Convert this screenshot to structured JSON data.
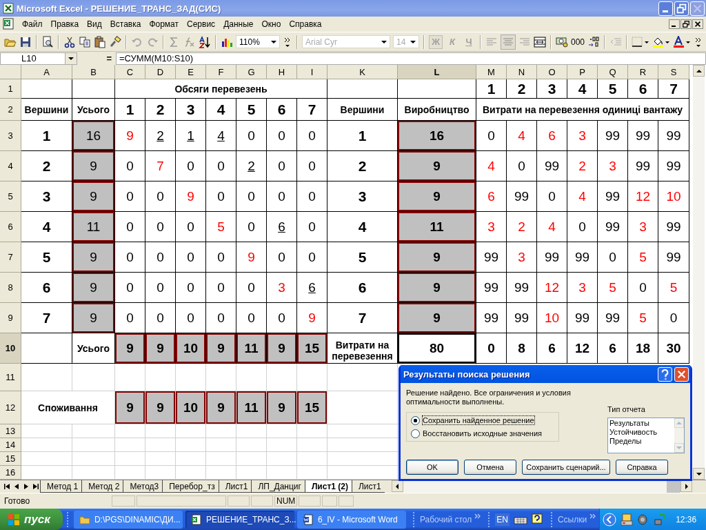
{
  "window": {
    "title": "Microsoft Excel - РЕШЕНИЕ_ТРАНС_ЗАД(СИС)"
  },
  "menu": [
    "Файл",
    "Правка",
    "Вид",
    "Вставка",
    "Формат",
    "Сервис",
    "Данные",
    "Окно",
    "Справка"
  ],
  "toolbar": {
    "zoom": "110%",
    "font": "Arial Cyr",
    "font_size": "14",
    "format_buttons": [
      {
        "label": "Ж",
        "pressed": true
      },
      {
        "label": "К",
        "pressed": false
      },
      {
        "label": "Ч",
        "pressed": false
      }
    ],
    "thousands": "000"
  },
  "formula_bar": {
    "name_box": "L10",
    "equals": "=",
    "formula": "=СУММ(M10:S10)"
  },
  "sheet": {
    "columns": [
      {
        "label": "A",
        "selected": false
      },
      {
        "label": "B",
        "selected": false
      },
      {
        "label": "C",
        "selected": false
      },
      {
        "label": "D",
        "selected": false
      },
      {
        "label": "E",
        "selected": false
      },
      {
        "label": "F",
        "selected": false
      },
      {
        "label": "G",
        "selected": false
      },
      {
        "label": "H",
        "selected": false
      },
      {
        "label": "I",
        "selected": false
      },
      {
        "label": "K",
        "selected": false
      },
      {
        "label": "L",
        "selected": true
      },
      {
        "label": "M",
        "selected": false
      },
      {
        "label": "N",
        "selected": false
      },
      {
        "label": "O",
        "selected": false
      },
      {
        "label": "P",
        "selected": false
      },
      {
        "label": "Q",
        "selected": false
      },
      {
        "label": "R",
        "selected": false
      },
      {
        "label": "S",
        "selected": false
      }
    ],
    "rows": [
      {
        "header": "1",
        "selected": false,
        "cells": [
          "",
          "",
          "",
          "",
          {
            "kind": "centered_heading",
            "text": "Обсяги перевезень"
          },
          "",
          "",
          "",
          "",
          "",
          "",
          {
            "kind": "index",
            "text": "1"
          },
          {
            "kind": "index",
            "text": "2"
          },
          {
            "kind": "index",
            "text": "3"
          },
          {
            "kind": "index",
            "text": "4"
          },
          {
            "kind": "index",
            "text": "5"
          },
          {
            "kind": "index",
            "text": "6"
          },
          {
            "kind": "index",
            "text": "7"
          }
        ]
      },
      {
        "header": "2",
        "selected": false,
        "cells": [
          {
            "kind": "heading",
            "text": "Вершини"
          },
          {
            "kind": "heading",
            "text": "Усього"
          },
          {
            "kind": "index",
            "text": "1"
          },
          {
            "kind": "index",
            "text": "2"
          },
          {
            "kind": "index",
            "text": "3"
          },
          {
            "kind": "index",
            "text": "4"
          },
          {
            "kind": "index",
            "text": "5"
          },
          {
            "kind": "index",
            "text": "6"
          },
          {
            "kind": "index",
            "text": "7"
          },
          {
            "kind": "heading",
            "text": "Вершини"
          },
          {
            "kind": "heading",
            "text": "Виробництво"
          },
          {
            "kind": "wide_heading",
            "text": "Витрати на перевезення одиниці вантажу"
          }
        ]
      },
      {
        "header": "3",
        "selected": false,
        "cells": [
          {
            "kind": "index",
            "text": "1"
          },
          {
            "kind": "shaded",
            "text": "16"
          },
          {
            "kind": "value",
            "color": "#ff0000",
            "text": "9"
          },
          {
            "kind": "value",
            "underline": true,
            "text": "2"
          },
          {
            "kind": "value",
            "underline": true,
            "text": "1"
          },
          {
            "kind": "value",
            "underline": true,
            "text": "4"
          },
          {
            "kind": "value",
            "text": "0"
          },
          {
            "kind": "value",
            "text": "0"
          },
          {
            "kind": "value",
            "text": "0"
          },
          {
            "kind": "index",
            "text": "1"
          },
          {
            "kind": "total",
            "text": "16"
          },
          {
            "kind": "value",
            "text": "0"
          },
          {
            "kind": "value",
            "color": "#ff0000",
            "text": "4"
          },
          {
            "kind": "value",
            "color": "#ff0000",
            "text": "6"
          },
          {
            "kind": "value",
            "color": "#ff0000",
            "text": "3"
          },
          {
            "kind": "value",
            "text": "99"
          },
          {
            "kind": "value",
            "text": "99"
          },
          {
            "kind": "value",
            "text": "99"
          }
        ]
      },
      {
        "header": "4",
        "selected": false,
        "cells": [
          {
            "kind": "index",
            "text": "2"
          },
          {
            "kind": "shaded",
            "text": "9"
          },
          {
            "kind": "value",
            "text": "0"
          },
          {
            "kind": "value",
            "color": "#ff0000",
            "text": "7"
          },
          {
            "kind": "value",
            "text": "0"
          },
          {
            "kind": "value",
            "text": "0"
          },
          {
            "kind": "value",
            "underline": true,
            "text": "2"
          },
          {
            "kind": "value",
            "text": "0"
          },
          {
            "kind": "value",
            "text": "0"
          },
          {
            "kind": "index",
            "text": "2"
          },
          {
            "kind": "total",
            "text": "9"
          },
          {
            "kind": "value",
            "color": "#ff0000",
            "text": "4"
          },
          {
            "kind": "value",
            "text": "0"
          },
          {
            "kind": "value",
            "text": "99"
          },
          {
            "kind": "value",
            "color": "#ff0000",
            "text": "2"
          },
          {
            "kind": "value",
            "color": "#ff0000",
            "text": "3"
          },
          {
            "kind": "value",
            "text": "99"
          },
          {
            "kind": "value",
            "text": "99"
          }
        ]
      },
      {
        "header": "5",
        "selected": false,
        "cells": [
          {
            "kind": "index",
            "text": "3"
          },
          {
            "kind": "shaded",
            "text": "9"
          },
          {
            "kind": "value",
            "text": "0"
          },
          {
            "kind": "value",
            "text": "0"
          },
          {
            "kind": "value",
            "color": "#ff0000",
            "text": "9"
          },
          {
            "kind": "value",
            "text": "0"
          },
          {
            "kind": "value",
            "text": "0"
          },
          {
            "kind": "value",
            "text": "0"
          },
          {
            "kind": "value",
            "text": "0"
          },
          {
            "kind": "index",
            "text": "3"
          },
          {
            "kind": "total",
            "text": "9"
          },
          {
            "kind": "value",
            "color": "#ff0000",
            "text": "6"
          },
          {
            "kind": "value",
            "text": "99"
          },
          {
            "kind": "value",
            "text": "0"
          },
          {
            "kind": "value",
            "color": "#ff0000",
            "text": "4"
          },
          {
            "kind": "value",
            "text": "99"
          },
          {
            "kind": "value",
            "color": "#ff0000",
            "text": "12"
          },
          {
            "kind": "value",
            "color": "#ff0000",
            "text": "10"
          }
        ]
      },
      {
        "header": "6",
        "selected": false,
        "cells": [
          {
            "kind": "index",
            "text": "4"
          },
          {
            "kind": "shaded",
            "text": "11"
          },
          {
            "kind": "value",
            "text": "0"
          },
          {
            "kind": "value",
            "text": "0"
          },
          {
            "kind": "value",
            "text": "0"
          },
          {
            "kind": "value",
            "color": "#ff0000",
            "text": "5"
          },
          {
            "kind": "value",
            "text": "0"
          },
          {
            "kind": "value",
            "underline": true,
            "text": "6"
          },
          {
            "kind": "value",
            "text": "0"
          },
          {
            "kind": "index",
            "text": "4"
          },
          {
            "kind": "total",
            "text": "11"
          },
          {
            "kind": "value",
            "color": "#ff0000",
            "text": "3"
          },
          {
            "kind": "value",
            "color": "#ff0000",
            "text": "2"
          },
          {
            "kind": "value",
            "color": "#ff0000",
            "text": "4"
          },
          {
            "kind": "value",
            "text": "0"
          },
          {
            "kind": "value",
            "text": "99"
          },
          {
            "kind": "value",
            "color": "#ff0000",
            "text": "3"
          },
          {
            "kind": "value",
            "text": "99"
          }
        ]
      },
      {
        "header": "7",
        "selected": false,
        "cells": [
          {
            "kind": "index",
            "text": "5"
          },
          {
            "kind": "shaded",
            "text": "9"
          },
          {
            "kind": "value",
            "text": "0"
          },
          {
            "kind": "value",
            "text": "0"
          },
          {
            "kind": "value",
            "text": "0"
          },
          {
            "kind": "value",
            "text": "0"
          },
          {
            "kind": "value",
            "color": "#ff0000",
            "text": "9"
          },
          {
            "kind": "value",
            "text": "0"
          },
          {
            "kind": "value",
            "text": "0"
          },
          {
            "kind": "index",
            "text": "5"
          },
          {
            "kind": "total",
            "text": "9"
          },
          {
            "kind": "value",
            "text": "99"
          },
          {
            "kind": "value",
            "color": "#ff0000",
            "text": "3"
          },
          {
            "kind": "value",
            "text": "99"
          },
          {
            "kind": "value",
            "text": "99"
          },
          {
            "kind": "value",
            "text": "0"
          },
          {
            "kind": "value",
            "color": "#ff0000",
            "text": "5"
          },
          {
            "kind": "value",
            "text": "99"
          }
        ]
      },
      {
        "header": "8",
        "selected": false,
        "cells": [
          {
            "kind": "index",
            "text": "6"
          },
          {
            "kind": "shaded",
            "text": "9"
          },
          {
            "kind": "value",
            "text": "0"
          },
          {
            "kind": "value",
            "text": "0"
          },
          {
            "kind": "value",
            "text": "0"
          },
          {
            "kind": "value",
            "text": "0"
          },
          {
            "kind": "value",
            "text": "0"
          },
          {
            "kind": "value",
            "color": "#ff0000",
            "text": "3"
          },
          {
            "kind": "value",
            "underline": true,
            "text": "6"
          },
          {
            "kind": "index",
            "text": "6"
          },
          {
            "kind": "total",
            "text": "9"
          },
          {
            "kind": "value",
            "text": "99"
          },
          {
            "kind": "value",
            "text": "99"
          },
          {
            "kind": "value",
            "color": "#ff0000",
            "text": "12"
          },
          {
            "kind": "value",
            "color": "#ff0000",
            "text": "3"
          },
          {
            "kind": "value",
            "color": "#ff0000",
            "text": "5"
          },
          {
            "kind": "value",
            "text": "0"
          },
          {
            "kind": "value",
            "color": "#ff0000",
            "text": "5"
          }
        ]
      },
      {
        "header": "9",
        "selected": false,
        "cells": [
          {
            "kind": "index",
            "text": "7"
          },
          {
            "kind": "shaded",
            "text": "9"
          },
          {
            "kind": "value",
            "text": "0"
          },
          {
            "kind": "value",
            "text": "0"
          },
          {
            "kind": "value",
            "text": "0"
          },
          {
            "kind": "value",
            "text": "0"
          },
          {
            "kind": "value",
            "text": "0"
          },
          {
            "kind": "value",
            "text": "0"
          },
          {
            "kind": "value",
            "color": "#ff0000",
            "text": "9"
          },
          {
            "kind": "index",
            "text": "7"
          },
          {
            "kind": "total",
            "text": "9"
          },
          {
            "kind": "value",
            "text": "99"
          },
          {
            "kind": "value",
            "text": "99"
          },
          {
            "kind": "value",
            "color": "#ff0000",
            "text": "10"
          },
          {
            "kind": "value",
            "text": "99"
          },
          {
            "kind": "value",
            "text": "99"
          },
          {
            "kind": "value",
            "color": "#ff0000",
            "text": "5"
          },
          {
            "kind": "value",
            "text": "0"
          }
        ]
      },
      {
        "header": "10",
        "selected": true,
        "cells": [
          "",
          {
            "kind": "heading",
            "text": "Усього"
          },
          {
            "kind": "total",
            "text": "9"
          },
          {
            "kind": "total",
            "text": "9"
          },
          {
            "kind": "total",
            "text": "10"
          },
          {
            "kind": "total",
            "text": "9"
          },
          {
            "kind": "total",
            "text": "11"
          },
          {
            "kind": "total",
            "text": "9"
          },
          {
            "kind": "total",
            "text": "15"
          },
          {
            "kind": "heading",
            "wrap": true,
            "text": "Витрати на перевезення"
          },
          {
            "kind": "sum",
            "selected": true,
            "text": "80"
          },
          {
            "kind": "sum",
            "text": "0"
          },
          {
            "kind": "sum",
            "text": "8"
          },
          {
            "kind": "sum",
            "text": "6"
          },
          {
            "kind": "sum",
            "text": "12"
          },
          {
            "kind": "sum",
            "text": "6"
          },
          {
            "kind": "sum",
            "text": "18"
          },
          {
            "kind": "sum",
            "text": "30"
          }
        ]
      },
      {
        "header": "11",
        "selected": false,
        "cells": []
      },
      {
        "header": "12",
        "selected": false,
        "cells": [
          {
            "kind": "pair_heading",
            "text": "Споживання"
          },
          "",
          {
            "kind": "total",
            "text": "9"
          },
          {
            "kind": "total",
            "text": "9"
          },
          {
            "kind": "total",
            "text": "10"
          },
          {
            "kind": "total",
            "text": "9"
          },
          {
            "kind": "total",
            "text": "11"
          },
          {
            "kind": "total",
            "text": "9"
          },
          {
            "kind": "total",
            "text": "15"
          }
        ]
      },
      {
        "header": "13",
        "selected": false,
        "cells": []
      },
      {
        "header": "14",
        "selected": false,
        "cells": []
      },
      {
        "header": "15",
        "selected": false,
        "cells": []
      },
      {
        "header": "16",
        "selected": false,
        "cells": []
      }
    ]
  },
  "sheet_tabs": [
    {
      "label": "Метод 1",
      "selected": false
    },
    {
      "label": "Метод 2",
      "selected": false
    },
    {
      "label": "Метод3",
      "selected": false
    },
    {
      "label": "Перебор_тз",
      "selected": false
    },
    {
      "label": "Лист1",
      "selected": false
    },
    {
      "label": "ЛП_Данциг",
      "selected": false
    },
    {
      "label": "Лист1 (2)",
      "selected": true
    },
    {
      "label": "Лист1",
      "selected": false
    }
  ],
  "status_bar": {
    "text": "Готово",
    "indicator": "NUM"
  },
  "dialog": {
    "title": "Результаты поиска решения",
    "message": "Решение найдено. Все ограничения и условия оптимальности выполнены.",
    "options": [
      {
        "label": "Сохранить найденное решение",
        "selected": true
      },
      {
        "label": "Восстановить исходные значения",
        "selected": false
      }
    ],
    "report_label": "Тип отчета",
    "reports": [
      "Результаты",
      "Устойчивость",
      "Пределы"
    ],
    "buttons": [
      "OK",
      "Отмена",
      "Сохранить сценарий...",
      "Справка"
    ]
  },
  "taskbar": {
    "start": "пуск",
    "tasks": [
      {
        "label": "D:\\PGS\\DINAMIC\\ДИ...",
        "kind": "folder",
        "selected": false
      },
      {
        "label": "РЕШЕНИЕ_ТРАНС_З...",
        "kind": "excel",
        "selected": true
      },
      {
        "label": "6_IV - Microsoft Word",
        "kind": "word",
        "selected": false
      }
    ],
    "desktop": "Рабочий стол",
    "language": "EN",
    "links": "Ссылки",
    "clock": "12:36"
  }
}
